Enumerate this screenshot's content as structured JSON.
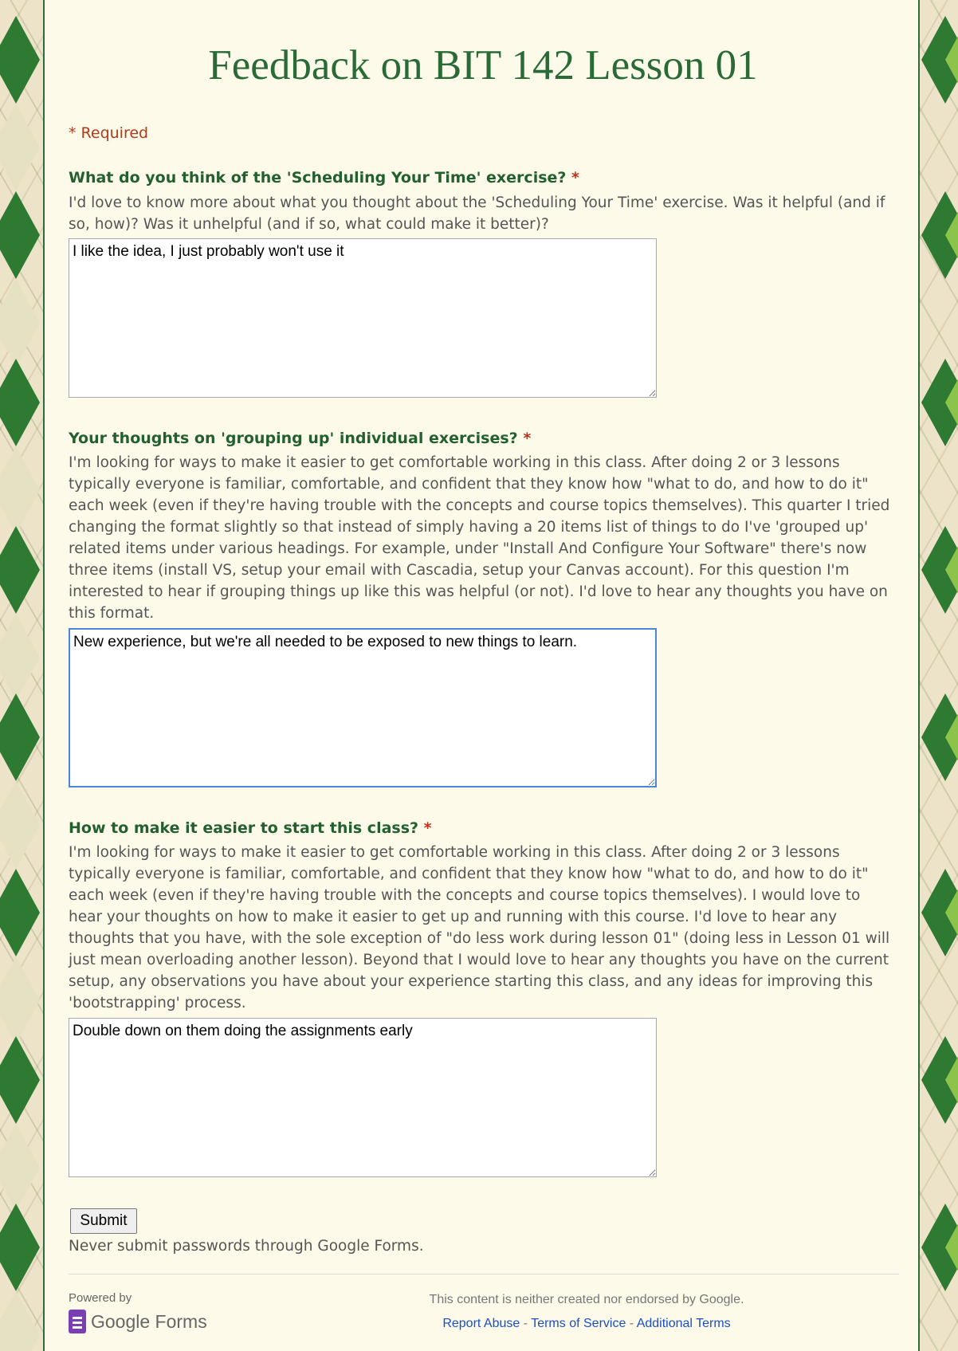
{
  "form": {
    "title": "Feedback on BIT 142 Lesson 01",
    "required_note": "* Required"
  },
  "questions": [
    {
      "title": "What do you think of the 'Scheduling Your Time' exercise?",
      "required_mark": "*",
      "help": "I'd love to know more about what you thought about the 'Scheduling Your Time' exercise. Was it helpful (and if so, how)? Was it unhelpful (and if so, what could make it better)?",
      "answer": "I like the idea, I just probably won't use it"
    },
    {
      "title": "Your thoughts on 'grouping up' individual exercises?",
      "required_mark": "*",
      "help": "I'm looking for ways to make it easier to get comfortable working in this class. After doing 2 or 3 lessons typically everyone is familiar, comfortable, and confident that they know how \"what to do, and how to do it\" each week (even if they're having trouble with the concepts and course topics themselves). This quarter I tried changing the format slightly so that instead of simply having a 20 items list of things to do I've 'grouped up' related items under various headings. For example, under \"Install And Configure Your Software\" there's now three items (install VS, setup your email with Cascadia, setup your Canvas account). For this question I'm interested to hear if grouping things up like this was helpful (or not). I'd love to hear any thoughts you have on this format.",
      "answer": "New experience, but we're all needed to be exposed to new things to learn."
    },
    {
      "title": "How to make it easier to start this class?",
      "required_mark": "*",
      "help": "I'm looking for ways to make it easier to get comfortable working in this class. After doing 2 or 3 lessons typically everyone is familiar, comfortable, and confident that they know how \"what to do, and how to do it\" each week (even if they're having trouble with the concepts and course topics themselves). I would love to hear your thoughts on how to make it easier to get up and running with this course. I'd love to hear any thoughts that you have, with the sole exception of \"do less work during lesson 01\" (doing less in Lesson 01 will just mean overloading another lesson). Beyond that I would love to hear any thoughts you have on the current setup, any observations you have about your experience starting this class, and any ideas for improving this 'bootstrapping' process.",
      "answer": "Double down on them doing the assignments early"
    }
  ],
  "submit_label": "Submit",
  "password_warning": "Never submit passwords through Google Forms.",
  "footer": {
    "powered_by": "Powered by",
    "logo_text": "Google Forms",
    "logo_icon": "google-forms-icon",
    "disclaimer": "This content is neither created nor endorsed by Google.",
    "report_abuse": "Report Abuse",
    "terms": "Terms of Service",
    "additional_terms": "Additional Terms",
    "separator": " - "
  },
  "colors": {
    "title_green": "#2a6a36",
    "required_red": "#b23a1a",
    "link_blue": "#1a4fc4",
    "focus_blue": "#4a86d8"
  }
}
